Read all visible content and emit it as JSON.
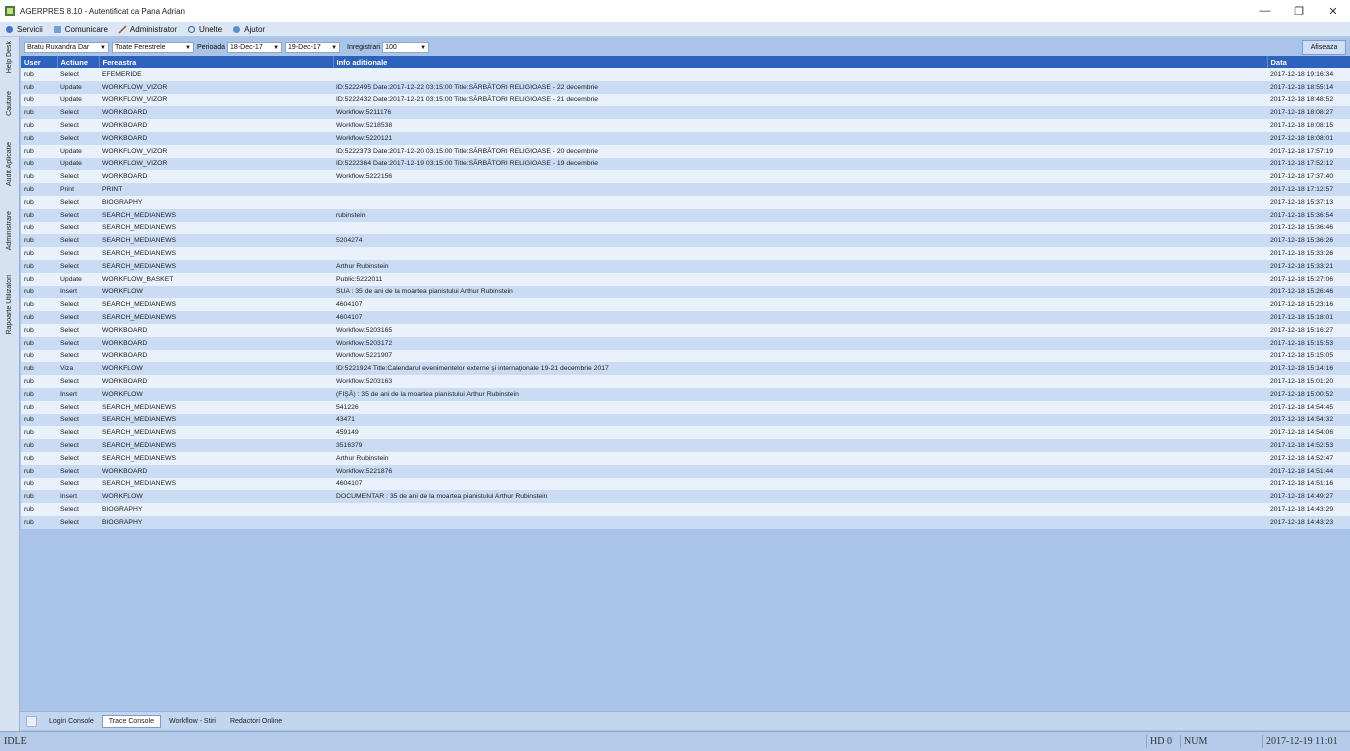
{
  "window": {
    "title": "AGERPRES 8.10 - Autentificat ca Pana Adrian"
  },
  "menu": [
    {
      "label": "Servicii",
      "icon": "services-icon"
    },
    {
      "label": "Comunicare",
      "icon": "communication-icon"
    },
    {
      "label": "Administrator",
      "icon": "admin-icon"
    },
    {
      "label": "Unelte",
      "icon": "tools-icon"
    },
    {
      "label": "Ajutor",
      "icon": "help-icon"
    }
  ],
  "sidebar": [
    {
      "label": "Help Desk",
      "color": "#3a7bd5"
    },
    {
      "label": "Cautare",
      "color": "#e8d36a"
    },
    {
      "label": "Audit Aplicatie",
      "color": "#6fae5a"
    },
    {
      "label": "Administrare",
      "color": "#d7a040"
    },
    {
      "label": "Rapoarte Utilizatori",
      "color": "#c9583a"
    }
  ],
  "toolbar": {
    "user_combo": "Bratu Ruxandra Dar",
    "window_combo": "Toate Ferestrele",
    "perioada_label": "Perioada",
    "date_from": "18-Dec-17",
    "date_to": "19-Dec-17",
    "inregistrari_label": "Inregistrari",
    "count": "100",
    "show_button": "Afiseaza"
  },
  "table": {
    "headers": [
      "User",
      "Actiune",
      "Fereastra",
      "Info aditionale",
      "Data"
    ],
    "rows": [
      [
        "rub",
        "Select",
        "EFEMERIDE",
        "",
        "2017-12-18 19:16:34"
      ],
      [
        "rub",
        "Update",
        "WORKFLOW_VIZOR",
        "ID:5222495 Date:2017-12-22 03:15:00 Title:SĂRBĂTORI RELIGIOASE - 22 decembrie",
        "2017-12-18 18:55:14"
      ],
      [
        "rub",
        "Update",
        "WORKFLOW_VIZOR",
        "ID:5222432 Date:2017-12-21 03:15:00 Title:SĂRBĂTORI RELIGIOASE - 21 decembrie",
        "2017-12-18 18:48:52"
      ],
      [
        "rub",
        "Select",
        "WORKBOARD",
        "Workflow:5211176",
        "2017-12-18 18:08:27"
      ],
      [
        "rub",
        "Select",
        "WORKBOARD",
        "Workflow:5218538",
        "2017-12-18 18:08:15"
      ],
      [
        "rub",
        "Select",
        "WORKBOARD",
        "Workflow:5220121",
        "2017-12-18 18:08:01"
      ],
      [
        "rub",
        "Update",
        "WORKFLOW_VIZOR",
        "ID:5222373 Date:2017-12-20 03:15:00 Title:SĂRBĂTORI RELIGIOASE - 20 decembrie",
        "2017-12-18 17:57:19"
      ],
      [
        "rub",
        "Update",
        "WORKFLOW_VIZOR",
        "ID:5222364 Date:2017-12-19 03:15:00 Title:SĂRBĂTORI RELIGIOASE - 19 decembrie",
        "2017-12-18 17:52:12"
      ],
      [
        "rub",
        "Select",
        "WORKBOARD",
        "Workflow:5222156",
        "2017-12-18 17:37:40"
      ],
      [
        "rub",
        "Print",
        "PRINT",
        "",
        "2017-12-18 17:12:57"
      ],
      [
        "rub",
        "Select",
        "BIOGRAPHY",
        "",
        "2017-12-18 15:37:13"
      ],
      [
        "rub",
        "Select",
        "SEARCH_MEDIANEWS",
        "rubinstein",
        "2017-12-18 15:36:54"
      ],
      [
        "rub",
        "Select",
        "SEARCH_MEDIANEWS",
        "",
        "2017-12-18 15:36:46"
      ],
      [
        "rub",
        "Select",
        "SEARCH_MEDIANEWS",
        "5204274",
        "2017-12-18 15:36:26"
      ],
      [
        "rub",
        "Select",
        "SEARCH_MEDIANEWS",
        "",
        "2017-12-18 15:33:26"
      ],
      [
        "rub",
        "Select",
        "SEARCH_MEDIANEWS",
        "Arthur Rubinstein",
        "2017-12-18 15:33:21"
      ],
      [
        "rub",
        "Update",
        "WORKFLOW_BASKET",
        "Public:5222011",
        "2017-12-18 15:27:06"
      ],
      [
        "rub",
        "Insert",
        "WORKFLOW",
        "SUA : 35 de ani de la moartea pianistului Arthur Rubinstein",
        "2017-12-18 15:26:46"
      ],
      [
        "rub",
        "Select",
        "SEARCH_MEDIANEWS",
        "4604107",
        "2017-12-18 15:23:16"
      ],
      [
        "rub",
        "Select",
        "SEARCH_MEDIANEWS",
        "4604107",
        "2017-12-18 15:18:01"
      ],
      [
        "rub",
        "Select",
        "WORKBOARD",
        "Workflow:5203165",
        "2017-12-18 15:16:27"
      ],
      [
        "rub",
        "Select",
        "WORKBOARD",
        "Workflow:5203172",
        "2017-12-18 15:15:53"
      ],
      [
        "rub",
        "Select",
        "WORKBOARD",
        "Workflow:5221907",
        "2017-12-18 15:15:05"
      ],
      [
        "rub",
        "Viza",
        "WORKFLOW",
        "ID:5221924 Title:Calendarul evenimentelor externe şi internaţionale 19-21 decembrie 2017",
        "2017-12-18 15:14:16"
      ],
      [
        "rub",
        "Select",
        "WORKBOARD",
        "Workflow:5203163",
        "2017-12-18 15:01:20"
      ],
      [
        "rub",
        "Insert",
        "WORKFLOW",
        "(FIŞĂ) : 35 de ani de la moartea pianistului Arthur Rubinstein",
        "2017-12-18 15:00:52"
      ],
      [
        "rub",
        "Select",
        "SEARCH_MEDIANEWS",
        "541226",
        "2017-12-18 14:54:45"
      ],
      [
        "rub",
        "Select",
        "SEARCH_MEDIANEWS",
        "43471",
        "2017-12-18 14:54:32"
      ],
      [
        "rub",
        "Select",
        "SEARCH_MEDIANEWS",
        "459149",
        "2017-12-18 14:54:06"
      ],
      [
        "rub",
        "Select",
        "SEARCH_MEDIANEWS",
        "3516379",
        "2017-12-18 14:52:53"
      ],
      [
        "rub",
        "Select",
        "SEARCH_MEDIANEWS",
        "Arthur Rubinstein",
        "2017-12-18 14:52:47"
      ],
      [
        "rub",
        "Select",
        "WORKBOARD",
        "Workflow:5221876",
        "2017-12-18 14:51:44"
      ],
      [
        "rub",
        "Select",
        "SEARCH_MEDIANEWS",
        "4604107",
        "2017-12-18 14:51:16"
      ],
      [
        "rub",
        "Insert",
        "WORKFLOW",
        "DOCUMENTAR : 35 de ani de la moartea pianistului Arthur Rubinstein",
        "2017-12-18 14:49:27"
      ],
      [
        "rub",
        "Select",
        "BIOGRAPHY",
        "",
        "2017-12-18 14:43:29"
      ],
      [
        "rub",
        "Select",
        "BIOGRAPHY",
        "",
        "2017-12-18 14:43:23"
      ]
    ]
  },
  "bottom_tabs": [
    {
      "label": "Login Console",
      "active": false
    },
    {
      "label": "Trace Console",
      "active": true
    },
    {
      "label": "Workflow - Stiri",
      "active": false
    },
    {
      "label": "Redactori Online",
      "active": false
    }
  ],
  "status": {
    "state": "IDLE",
    "hd": "HD 0",
    "num": "NUM",
    "datetime": "2017-12-19 11:01"
  }
}
